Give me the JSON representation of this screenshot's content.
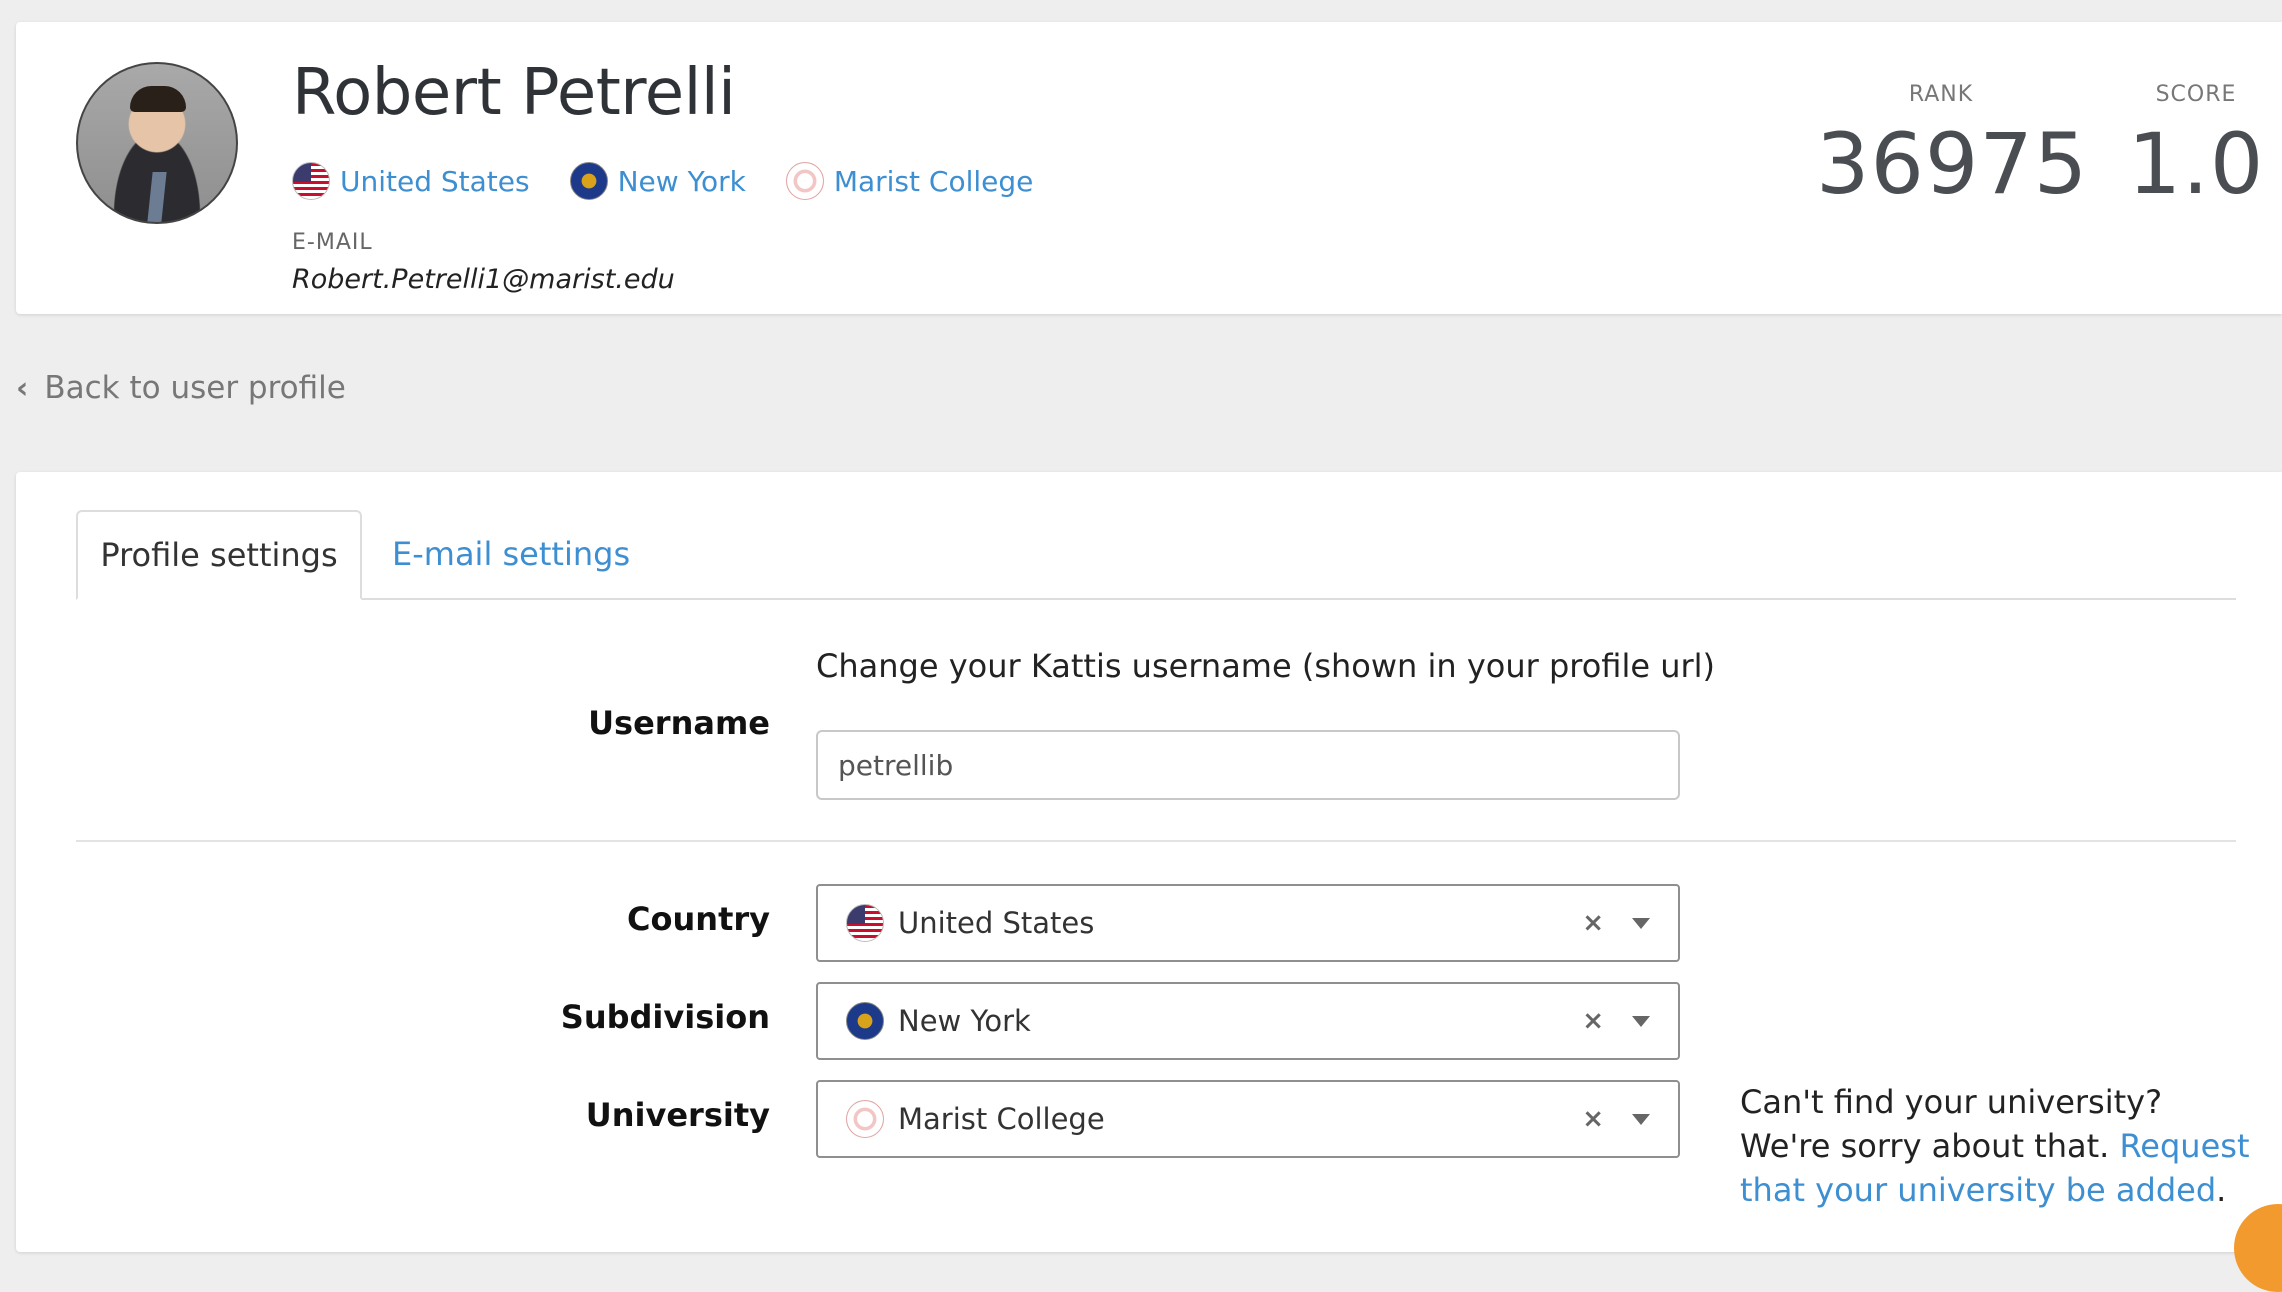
{
  "user": {
    "name": "Robert Petrelli",
    "country": "United States",
    "subdivision": "New York",
    "university": "Marist College",
    "email_label": "E-MAIL",
    "email": "Robert.Petrelli1@marist.edu"
  },
  "stats": {
    "rank_label": "RANK",
    "rank": "36975",
    "score_label": "SCORE",
    "score": "1.0"
  },
  "nav": {
    "back_label": "Back to user profile"
  },
  "tabs": [
    {
      "label": "Profile settings",
      "active": true
    },
    {
      "label": "E-mail settings",
      "active": false
    }
  ],
  "form": {
    "username_hint": "Change your Kattis username (shown in your profile url)",
    "username_label": "Username",
    "username_value": "petrellib",
    "country_label": "Country",
    "country_value": "United States",
    "subdivision_label": "Subdivision",
    "subdivision_value": "New York",
    "university_label": "University",
    "university_value": "Marist College",
    "clear_glyph": "×",
    "university_help_text": "Can't find your university? We're sorry about that.",
    "university_help_link": "Request that your university be added",
    "university_help_end": "."
  },
  "colors": {
    "link": "#3d8fd1",
    "background": "#eeeeee"
  }
}
